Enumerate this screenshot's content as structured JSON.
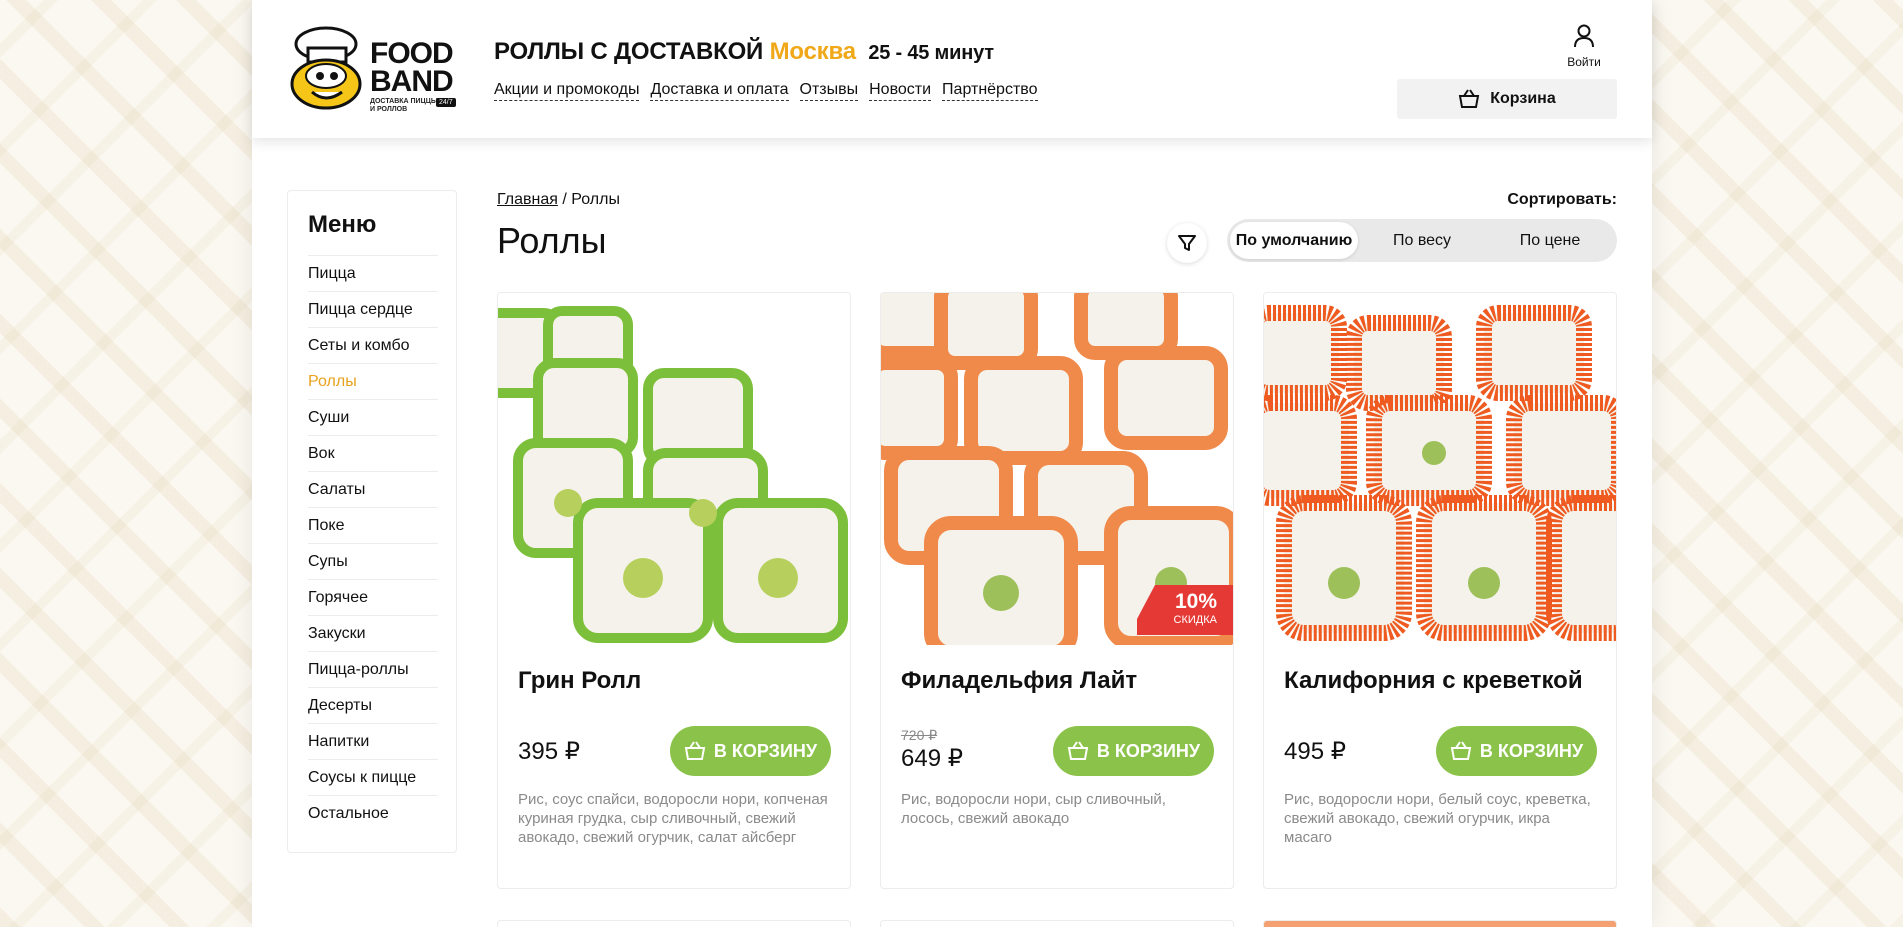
{
  "logo": {
    "brand": "FOOD BAND",
    "tagline": "ДОСТАВКА ПИЦЦЫ И РОЛЛОВ",
    "badge": "24/7"
  },
  "header": {
    "title": "РОЛЛЫ С ДОСТАВКОЙ",
    "city": "Москва",
    "delivery_time": "25 - 45 минут",
    "nav": [
      "Акции и промокоды",
      "Доставка и оплата",
      "Отзывы",
      "Новости",
      "Партнёрство"
    ],
    "login_label": "Войти",
    "cart_label": "Корзина"
  },
  "sidebar": {
    "title": "Меню",
    "items": [
      "Пицца",
      "Пицца сердце",
      "Сеты и комбо",
      "Роллы",
      "Суши",
      "Вок",
      "Салаты",
      "Поке",
      "Супы",
      "Горячее",
      "Закуски",
      "Пицца-роллы",
      "Десерты",
      "Напитки",
      "Соусы к пицце",
      "Остальное"
    ],
    "active": "Роллы"
  },
  "breadcrumb": {
    "home": "Главная",
    "separator": "/",
    "current": "Роллы"
  },
  "page_title": "Роллы",
  "sort": {
    "label": "Сортировать:",
    "options": [
      "По умолчанию",
      "По весу",
      "По цене"
    ],
    "active": "По умолчанию"
  },
  "products": [
    {
      "name": "Грин Ролл",
      "price": "395 ₽",
      "button": "В корзину",
      "description": "Рис, соус спайси, водоросли нори, копченая куриная грудка, сыр сливочный, свежий авокадо, свежий огурчик, салат айсберг"
    },
    {
      "name": "Филадельфия Лайт",
      "old_price": "720 ₽",
      "price": "649 ₽",
      "button": "В корзину",
      "discount": "10%",
      "discount_label": "скидка",
      "description": "Рис, водоросли нори, сыр сливочный, лосось, свежий авокадо"
    },
    {
      "name": "Калифорния с креветкой",
      "price": "495 ₽",
      "button": "В корзину",
      "description": "Рис, водоросли нори, белый соус, креветка, свежий авокадо, свежий огурчик, икра масаго"
    }
  ],
  "colors": {
    "accent": "#f0a818",
    "button_green": "#8bc34a",
    "discount_red": "#e53935",
    "active_menu": "#e8a21c"
  },
  "icons": [
    "chef-mascot-icon",
    "user-icon",
    "basket-icon",
    "filter-icon"
  ]
}
